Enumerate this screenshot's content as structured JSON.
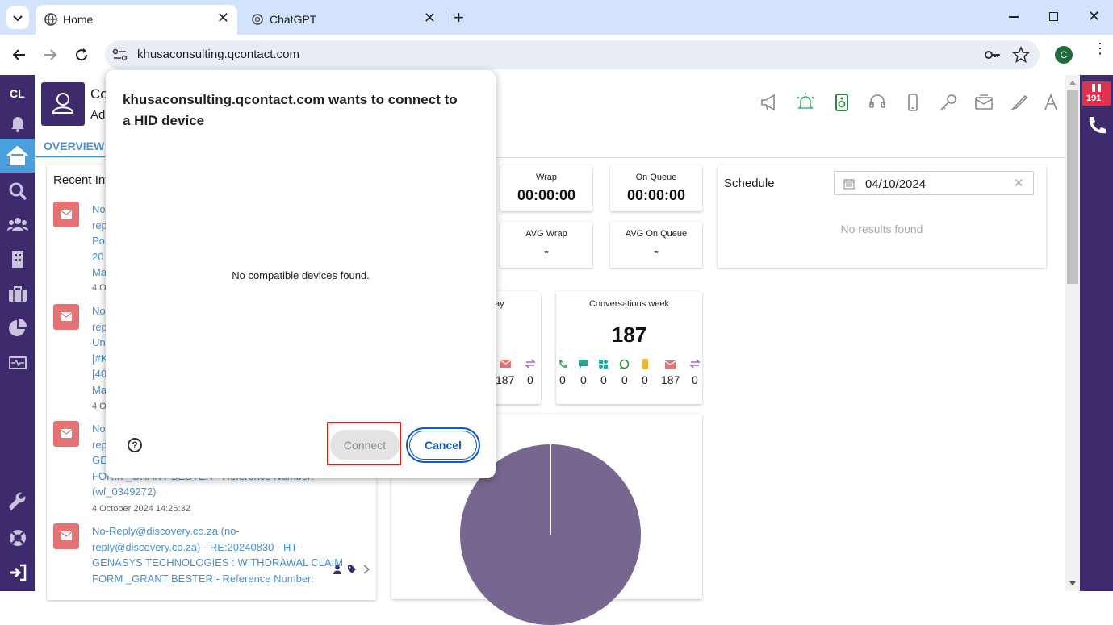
{
  "browser": {
    "tabs": [
      {
        "title": "Home",
        "active": true
      },
      {
        "title": "ChatGPT",
        "active": false
      }
    ],
    "new_tab_symbol": "+",
    "url": "khusaconsulting.qcontact.com",
    "profile_initial": "C"
  },
  "app": {
    "nav_initials": "CL",
    "user_name_partial": "Co",
    "user_role_partial": "Ad",
    "tab_overview": "OVERVIEW",
    "recent_title_partial": "Recent Int",
    "stats": {
      "wrap_label": "Wrap",
      "wrap_value": "00:00:00",
      "on_queue_label": "On Queue",
      "on_queue_value": "00:00:00",
      "avg_wrap_label": "AVG Wrap",
      "avg_wrap_value": "-",
      "avg_on_queue_label": "AVG On Queue",
      "avg_on_queue_value": "-"
    },
    "schedule": {
      "title": "Schedule",
      "date": "04/10/2024",
      "empty": "No results found"
    },
    "conv_today_partial": "ay",
    "conv_today_counts_partial": [
      "187",
      "0"
    ],
    "conv_week": {
      "label": "Conversations week",
      "total": "187",
      "counts": [
        "0",
        "0",
        "0",
        "0",
        "0",
        "187",
        "0"
      ]
    },
    "right_badge": "191",
    "recent_items": [
      {
        "lines": [
          "No",
          "rep",
          "Po",
          "20",
          "Ma"
        ],
        "date": "4 O"
      },
      {
        "lines": [
          "No",
          "rep",
          "Un",
          "[#K",
          "[40",
          "Ma"
        ],
        "date": "4 O"
      },
      {
        "lines": [
          "No",
          "rep",
          "GE",
          "FORM _GRANT BESTER - Reference Number:",
          "(wf_0349272)"
        ],
        "date": "4 October 2024 14:26:32"
      },
      {
        "lines": [
          "No-Reply@discovery.co.za (no-",
          "reply@discovery.co.za) - RE:20240830 - HT -",
          "GENASYS TECHNOLOGIES : WITHDRAWAL CLAIM",
          "FORM _GRANT BESTER - Reference Number:"
        ],
        "date": ""
      }
    ]
  },
  "dialog": {
    "heading": "khusaconsulting.qcontact.com wants to connect to a HID device",
    "empty_message": "No compatible devices found.",
    "help_symbol": "?",
    "connect_label": "Connect",
    "cancel_label": "Cancel"
  },
  "colors": {
    "sidebar": "#3e2b6e",
    "accent_blue": "#0b57d0",
    "pie": "#77668f",
    "highlight": "#e31a1a"
  }
}
